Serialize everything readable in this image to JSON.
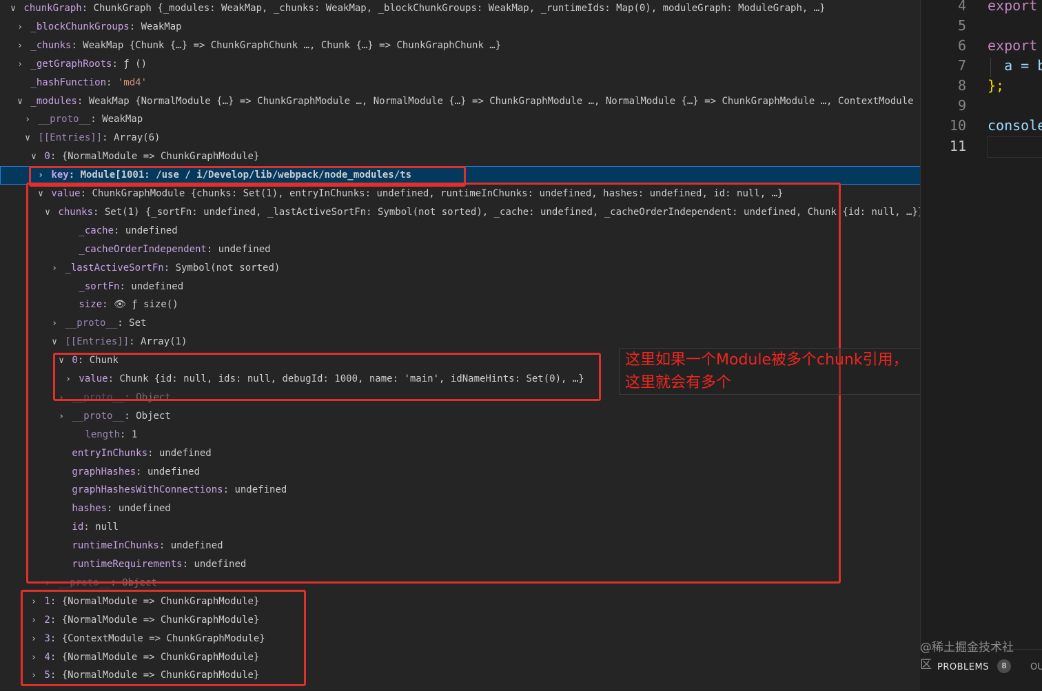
{
  "debug_tree": {
    "rows": [
      {
        "twisty": "open",
        "key": "chunkGraph",
        "key_dim": false,
        "value": "ChunkGraph {_modules: WeakMap, _chunks: WeakMap, _blockChunkGroups: WeakMap, _runtimeIds: Map(0), moduleGraph: ModuleGraph, …}"
      },
      {
        "twisty": "closed",
        "key": "_blockChunkGroups",
        "key_dim": false,
        "value": "WeakMap"
      },
      {
        "twisty": "closed",
        "key": "_chunks",
        "key_dim": false,
        "value": "WeakMap {Chunk {…} => ChunkGraphChunk …, Chunk {…} => ChunkGraphChunk …}"
      },
      {
        "twisty": "closed",
        "key": "_getGraphRoots",
        "key_dim": false,
        "value": "ƒ ()"
      },
      {
        "twisty": "none",
        "key": "_hashFunction",
        "key_dim": false,
        "value": "'md4'",
        "string": true
      },
      {
        "twisty": "open",
        "key": "_modules",
        "key_dim": false,
        "value": "WeakMap {NormalModule {…} => ChunkGraphModule …, NormalModule {…} => ChunkGraphModule …, NormalModule {…} => ChunkGraphModule …, ContextModule {…} =…"
      },
      {
        "twisty": "closed",
        "key": "__proto__",
        "key_dim": true,
        "value": "WeakMap"
      },
      {
        "twisty": "open",
        "key": "[[Entries]]",
        "key_dim": true,
        "value": "Array(6)"
      },
      {
        "twisty": "open",
        "key": "0",
        "key_dim": false,
        "value": "{NormalModule => ChunkGraphModule}"
      },
      {
        "twisty": "closed",
        "key": "key",
        "key_dim": false,
        "value": "Module[1001: /use   /      i/Develop/lib/webpack/node_modules/ts",
        "selected": true
      },
      {
        "twisty": "open",
        "key": "value",
        "key_dim": false,
        "value": "ChunkGraphModule {chunks: Set(1), entryInChunks: undefined, runtimeInChunks: undefined, hashes: undefined, id: null, …}"
      },
      {
        "twisty": "open",
        "key": "chunks",
        "key_dim": false,
        "value": "Set(1) {_sortFn: undefined, _lastActiveSortFn: Symbol(not sorted), _cache: undefined, _cacheOrderIndependent: undefined, Chunk {id: null, …}}"
      },
      {
        "twisty": "none",
        "key": "_cache",
        "key_dim": false,
        "value": "undefined"
      },
      {
        "twisty": "none",
        "key": "_cacheOrderIndependent",
        "key_dim": false,
        "value": "undefined"
      },
      {
        "twisty": "closed",
        "key": "_lastActiveSortFn",
        "key_dim": false,
        "value": "Symbol(not sorted)"
      },
      {
        "twisty": "none",
        "key": "_sortFn",
        "key_dim": false,
        "value": "undefined"
      },
      {
        "twisty": "none",
        "key": "size",
        "key_dim": false,
        "value": "👁 ƒ size()"
      },
      {
        "twisty": "closed",
        "key": "__proto__",
        "key_dim": true,
        "value": "Set"
      },
      {
        "twisty": "open",
        "key": "[[Entries]]",
        "key_dim": true,
        "value": "Array(1)"
      },
      {
        "twisty": "open",
        "key": "0",
        "key_dim": false,
        "value": "Chunk"
      },
      {
        "twisty": "closed",
        "key": "value",
        "key_dim": false,
        "value": "Chunk {id: null, ids: null, debugId: 1000, name: 'main', idNameHints: Set(0), …}"
      },
      {
        "twisty": "closed",
        "key": "__proto__",
        "key_dim": true,
        "value": "Object",
        "ghost": true
      },
      {
        "twisty": "closed",
        "key": "__proto__",
        "key_dim": true,
        "value": "Object"
      },
      {
        "twisty": "none",
        "key": "length",
        "key_dim": true,
        "value": "1"
      },
      {
        "twisty": "none",
        "key": "entryInChunks",
        "key_dim": false,
        "value": "undefined"
      },
      {
        "twisty": "none",
        "key": "graphHashes",
        "key_dim": false,
        "value": "undefined"
      },
      {
        "twisty": "none",
        "key": "graphHashesWithConnections",
        "key_dim": false,
        "value": "undefined"
      },
      {
        "twisty": "none",
        "key": "hashes",
        "key_dim": false,
        "value": "undefined"
      },
      {
        "twisty": "none",
        "key": "id",
        "key_dim": false,
        "value": "null"
      },
      {
        "twisty": "none",
        "key": "runtimeInChunks",
        "key_dim": false,
        "value": "undefined"
      },
      {
        "twisty": "none",
        "key": "runtimeRequirements",
        "key_dim": false,
        "value": "undefined"
      },
      {
        "twisty": "closed",
        "key": "__proto__",
        "key_dim": true,
        "value": "Object",
        "ghost": true
      },
      {
        "twisty": "closed",
        "key": "1",
        "key_dim": false,
        "value": "{NormalModule => ChunkGraphModule}"
      },
      {
        "twisty": "closed",
        "key": "2",
        "key_dim": false,
        "value": "{NormalModule => ChunkGraphModule}"
      },
      {
        "twisty": "closed",
        "key": "3",
        "key_dim": false,
        "value": "{ContextModule => ChunkGraphModule}"
      },
      {
        "twisty": "closed",
        "key": "4",
        "key_dim": false,
        "value": "{NormalModule => ChunkGraphModule}"
      },
      {
        "twisty": "closed",
        "key": "5",
        "key_dim": false,
        "value": "{NormalModule => ChunkGraphModule}"
      }
    ]
  },
  "annotation": {
    "line1": "这里如果一个Module被多个chunk引用，",
    "line2": "这里就会有多个",
    "color": "#f0261e"
  },
  "editor": {
    "lines": [
      {
        "num": "4",
        "code": "export"
      },
      {
        "num": "5",
        "code": ""
      },
      {
        "num": "6",
        "code": "export"
      },
      {
        "num": "7",
        "code": "  a = b"
      },
      {
        "num": "8",
        "code": "};"
      },
      {
        "num": "9",
        "code": ""
      },
      {
        "num": "10",
        "code": "console"
      },
      {
        "num": "11",
        "code": ""
      }
    ]
  },
  "panel": {
    "problems_label": "PROBLEMS",
    "problems_count": "8",
    "output_label": "OU"
  },
  "watermark": "@稀土掘金技术社区",
  "colors": {
    "highlight_box": "#e0302b",
    "selected_row": "#04395e",
    "property_key": "#c8a3e6",
    "string_value": "#ce9178"
  }
}
